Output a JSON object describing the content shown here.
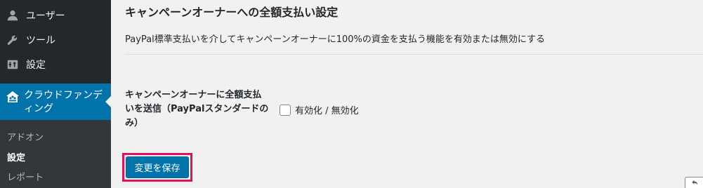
{
  "sidebar": {
    "items": [
      {
        "label": "ユーザー",
        "icon": "users-icon"
      },
      {
        "label": "ツール",
        "icon": "tools-icon"
      },
      {
        "label": "設定",
        "icon": "settings-icon"
      }
    ],
    "active": {
      "label": "クラウドファンディング",
      "icon": "crowdfunding-icon"
    },
    "submenu": [
      {
        "label": "アドオン"
      },
      {
        "label": "設定"
      },
      {
        "label": "レポート"
      }
    ]
  },
  "main": {
    "section_title": "キャンペーンオーナーへの全額支払い設定",
    "section_description": "PayPal標準支払いを介してキャンペーンオーナーに100%の資金を支払う機能を有効または無効にする",
    "field": {
      "label": "キャンペーンオーナーに全額支払いを送信（PayPalスタンダードのみ）",
      "checkbox_label": "有効化 / 無効化",
      "checked": false
    },
    "save_button": "変更を保存"
  },
  "colors": {
    "sidebar_bg": "#23282d",
    "active_bg": "#0073aa",
    "highlight": "#e0115f"
  }
}
